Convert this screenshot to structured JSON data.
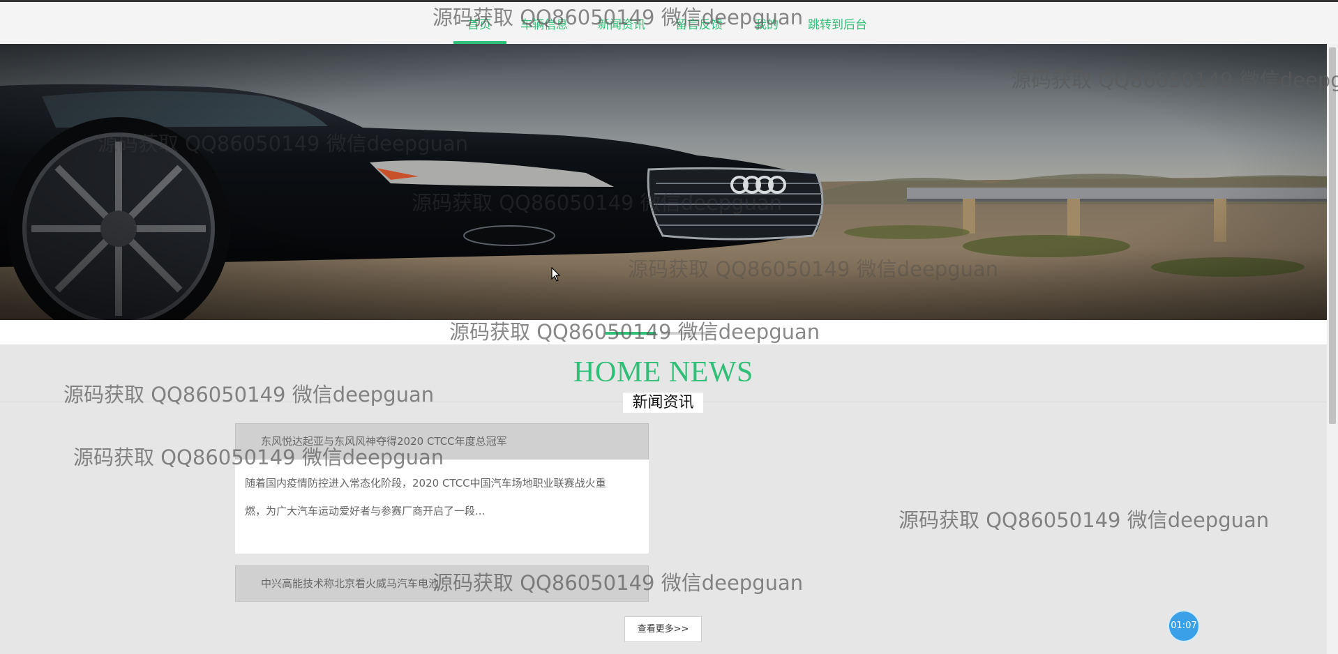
{
  "nav": {
    "items": [
      {
        "label": "首页",
        "active": true
      },
      {
        "label": "车辆信息"
      },
      {
        "label": "新闻资讯"
      },
      {
        "label": "留言反馈"
      },
      {
        "label": "我的"
      },
      {
        "label": "跳转到后台"
      }
    ],
    "accent": "#2fbf76"
  },
  "banner": {
    "alt": "black Audi car on gravel roadside",
    "slides": 2,
    "active_slide": 1
  },
  "news": {
    "title": "HOME NEWS",
    "subtitle": "新闻资讯",
    "items": [
      {
        "title": "东风悦达起亚与东风风神夺得2020 CTCC年度总冠军",
        "summary_line1": "随着国内疫情防控进入常态化阶段，2020 CTCC中国汽车场地职业联赛战火重",
        "summary_line2": "燃，为广大汽车运动爱好者与参赛厂商开启了一段..."
      },
      {
        "title": "中兴高能技术称北京看火威马汽车电池"
      }
    ],
    "more_label": "查看更多>>"
  },
  "timer": {
    "label": "01:07",
    "color": "#3aa0e8"
  },
  "watermark": {
    "text": "源码获取 QQ86050149 微信deepguan"
  }
}
